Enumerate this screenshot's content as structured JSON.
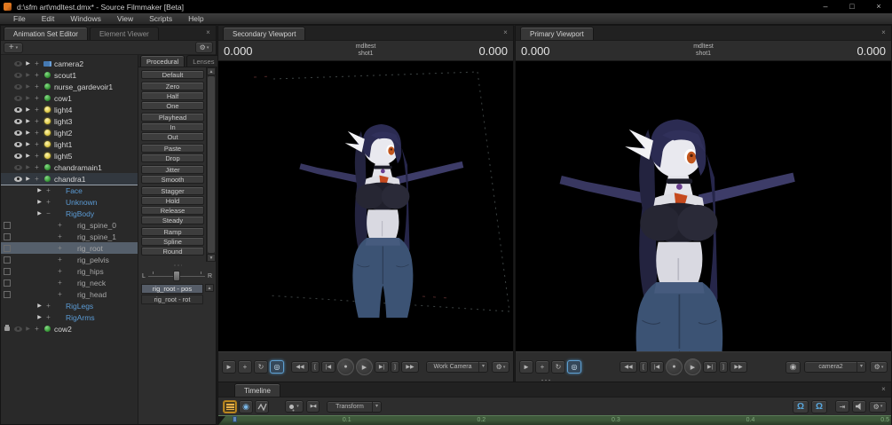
{
  "window": {
    "title": "d:\\sfm art\\mdltest.dmx* - Source Filmmaker [Beta]",
    "minimize": "–",
    "maximize": "□",
    "close": "×"
  },
  "menu": [
    "File",
    "Edit",
    "Windows",
    "View",
    "Scripts",
    "Help"
  ],
  "ase": {
    "tab_active": "Animation Set Editor",
    "tab_inactive": "Element Viewer",
    "close": "×",
    "add": "+",
    "gear": "⚙",
    "tree": [
      {
        "label": "camera2",
        "pre": "none",
        "eye": "dim",
        "arrow": "on",
        "pm": "plus",
        "icon": "camera",
        "cls": "w",
        "sel": "no",
        "ind": "i0"
      },
      {
        "label": "scout1",
        "pre": "none",
        "eye": "dim",
        "arrow": "dim",
        "pm": "plus",
        "icon": "ball",
        "cls": "w",
        "sel": "no",
        "ind": "i0"
      },
      {
        "label": "nurse_gardevoir1",
        "pre": "none",
        "eye": "dim",
        "arrow": "dim",
        "pm": "plus",
        "icon": "ball",
        "cls": "w",
        "sel": "no",
        "ind": "i0"
      },
      {
        "label": "cow1",
        "pre": "none",
        "eye": "dim",
        "arrow": "dim",
        "pm": "plus",
        "icon": "ball",
        "cls": "w",
        "sel": "no",
        "ind": "i0"
      },
      {
        "label": "light4",
        "pre": "none",
        "eye": "on",
        "arrow": "on",
        "pm": "plus",
        "icon": "light",
        "cls": "w",
        "sel": "no",
        "ind": "i0"
      },
      {
        "label": "light3",
        "pre": "none",
        "eye": "on",
        "arrow": "on",
        "pm": "plus",
        "icon": "light",
        "cls": "w",
        "sel": "no",
        "ind": "i0"
      },
      {
        "label": "light2",
        "pre": "none",
        "eye": "on",
        "arrow": "on",
        "pm": "plus",
        "icon": "light",
        "cls": "w",
        "sel": "no",
        "ind": "i0"
      },
      {
        "label": "light1",
        "pre": "none",
        "eye": "on",
        "arrow": "on",
        "pm": "plus",
        "icon": "light",
        "cls": "w",
        "sel": "no",
        "ind": "i0"
      },
      {
        "label": "light5",
        "pre": "none",
        "eye": "on",
        "arrow": "on",
        "pm": "plus",
        "icon": "light",
        "cls": "w",
        "sel": "no",
        "ind": "i0"
      },
      {
        "label": "chandramain1",
        "pre": "none",
        "eye": "dim",
        "arrow": "dim",
        "pm": "plus",
        "icon": "ball",
        "cls": "w",
        "sel": "no",
        "ind": "i0"
      },
      {
        "label": "chandra1",
        "pre": "none",
        "eye": "on",
        "arrow": "on",
        "pm": "plus",
        "icon": "ball",
        "cls": "w",
        "sel": "ul",
        "ind": "i0"
      },
      {
        "label": "Face",
        "pre": "none",
        "eye": "none",
        "arrow": "on",
        "pm": "plus",
        "icon": "none",
        "cls": "b",
        "sel": "no",
        "ind": "i1"
      },
      {
        "label": "Unknown",
        "pre": "none",
        "eye": "none",
        "arrow": "on",
        "pm": "plus",
        "icon": "none",
        "cls": "b",
        "sel": "no",
        "ind": "i1"
      },
      {
        "label": "RigBody",
        "pre": "none",
        "eye": "none",
        "arrow": "on",
        "pm": "minus",
        "icon": "none",
        "cls": "b",
        "sel": "no",
        "ind": "i1"
      },
      {
        "label": "rig_spine_0",
        "pre": "box",
        "eye": "none",
        "arrow": "none",
        "pm": "plus",
        "icon": "none",
        "cls": "g",
        "sel": "no",
        "ind": "i2"
      },
      {
        "label": "rig_spine_1",
        "pre": "box",
        "eye": "none",
        "arrow": "none",
        "pm": "plus",
        "icon": "none",
        "cls": "g",
        "sel": "no",
        "ind": "i2"
      },
      {
        "label": "rig_root",
        "pre": "box",
        "eye": "none",
        "arrow": "none",
        "pm": "plus",
        "icon": "none",
        "cls": "g",
        "sel": "hl",
        "ind": "i2"
      },
      {
        "label": "rig_pelvis",
        "pre": "box",
        "eye": "none",
        "arrow": "none",
        "pm": "plus",
        "icon": "none",
        "cls": "g",
        "sel": "no",
        "ind": "i2"
      },
      {
        "label": "rig_hips",
        "pre": "box",
        "eye": "none",
        "arrow": "none",
        "pm": "plus",
        "icon": "none",
        "cls": "g",
        "sel": "no",
        "ind": "i2"
      },
      {
        "label": "rig_neck",
        "pre": "box",
        "eye": "none",
        "arrow": "none",
        "pm": "plus",
        "icon": "none",
        "cls": "g",
        "sel": "no",
        "ind": "i2"
      },
      {
        "label": "rig_head",
        "pre": "box",
        "eye": "none",
        "arrow": "none",
        "pm": "plus",
        "icon": "none",
        "cls": "g",
        "sel": "no",
        "ind": "i2"
      },
      {
        "label": "RigLegs",
        "pre": "none",
        "eye": "none",
        "arrow": "on",
        "pm": "plus",
        "icon": "none",
        "cls": "b",
        "sel": "no",
        "ind": "i1"
      },
      {
        "label": "RigArms",
        "pre": "none",
        "eye": "none",
        "arrow": "on",
        "pm": "plus",
        "icon": "none",
        "cls": "b",
        "sel": "no",
        "ind": "i1"
      },
      {
        "label": "cow2",
        "pre": "lock",
        "eye": "dim",
        "arrow": "dim",
        "pm": "plus",
        "icon": "ball",
        "cls": "w",
        "sel": "no",
        "ind": "i0"
      }
    ],
    "presets": {
      "tab_active": "Procedural",
      "tab_inactive": "Lenses",
      "scroll_up": "▲",
      "scroll_down": "▼",
      "buttons": [
        {
          "label": "Default",
          "gap": "no"
        },
        {
          "label": "Zero",
          "gap": "yes"
        },
        {
          "label": "Half",
          "gap": "no"
        },
        {
          "label": "One",
          "gap": "no"
        },
        {
          "label": "Playhead",
          "gap": "yes"
        },
        {
          "label": "In",
          "gap": "no"
        },
        {
          "label": "Out",
          "gap": "no"
        },
        {
          "label": "Paste",
          "gap": "yes"
        },
        {
          "label": "Drop",
          "gap": "no"
        },
        {
          "label": "Jitter",
          "gap": "yes"
        },
        {
          "label": "Smooth",
          "gap": "no"
        },
        {
          "label": "Stagger",
          "gap": "yes"
        },
        {
          "label": "Hold",
          "gap": "no"
        },
        {
          "label": "Release",
          "gap": "no"
        },
        {
          "label": "Steady",
          "gap": "no"
        },
        {
          "label": "Ramp",
          "gap": "yes"
        },
        {
          "label": "Spline",
          "gap": "no"
        },
        {
          "label": "Round",
          "gap": "no"
        }
      ]
    },
    "slider": {
      "left": "L",
      "right": "R"
    },
    "channels": [
      {
        "label": "rig_root - pos",
        "sel": "yes"
      },
      {
        "label": "rig_root - rot",
        "sel": "no"
      }
    ],
    "channel_scroll_up": "▲"
  },
  "secondary": {
    "tab": "Secondary Viewport",
    "close": "×",
    "time_left": "0.000",
    "time_right": "0.000",
    "session": "mdltest",
    "shot": "shot1",
    "tools": [
      "►",
      "+",
      "↻",
      "◎"
    ],
    "transport": [
      "◀◀",
      "[",
      "|◀",
      "●",
      "▶",
      "▶|",
      "]",
      "▶▶"
    ],
    "camera": "Work Camera",
    "camera_arrow": "▾",
    "gear": "⚙",
    "gear_arrow": "▾"
  },
  "primary": {
    "tab": "Primary Viewport",
    "close": "×",
    "time_left": "0.000",
    "time_right": "0.000",
    "session": "mdltest",
    "shot": "shot1",
    "tools": [
      "►",
      "+",
      "↻",
      "◎"
    ],
    "transport": [
      "◀◀",
      "[",
      "|◀",
      "●",
      "▶",
      "▶|",
      "]",
      "▶▶"
    ],
    "reel": "◉",
    "camera": "camera2",
    "camera_arrow": "▾",
    "gear": "⚙",
    "gear_arrow": "▾"
  },
  "timeline": {
    "tab": "Timeline",
    "close": "×",
    "motion_icon": "◉",
    "bowtie_icon": "▶◀",
    "pin_arrow": "▾",
    "transform": "Transform",
    "transform_arrow": "▾",
    "snap1": "Ω",
    "snap2": "Ω",
    "to_end": "⇥",
    "gear": "⚙",
    "gear_arrow": "▾",
    "ruler": [
      "0.1",
      "0.2",
      "0.3",
      "0.4",
      "0.5"
    ]
  },
  "colors": {
    "accent_blue": "#5b9bd5",
    "accent_orange": "#d89e3c",
    "timeline_green": "#3f5a3c",
    "selection_gray": "#555f6b"
  }
}
